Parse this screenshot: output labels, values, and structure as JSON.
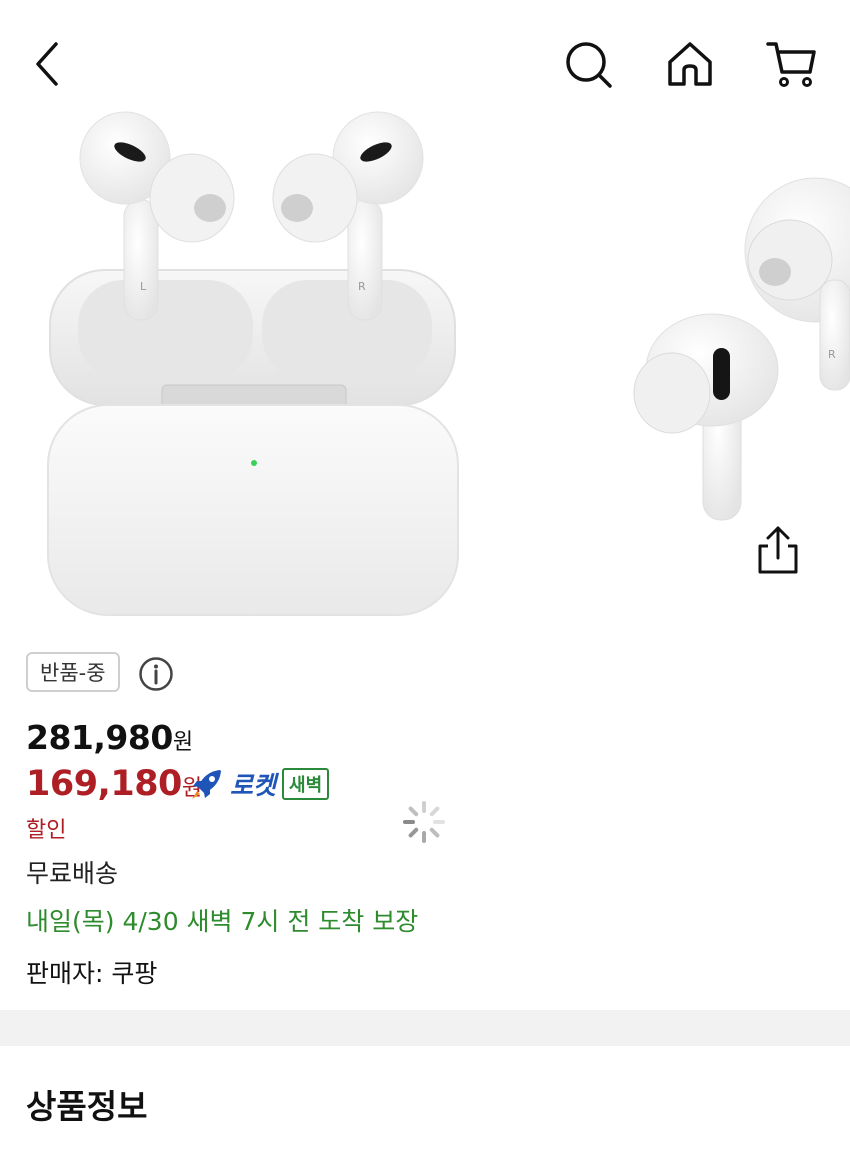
{
  "header": {
    "back_icon": "chevron-left-icon",
    "search_icon": "search-icon",
    "home_icon": "home-icon",
    "cart_icon": "cart-icon"
  },
  "gallery": {
    "share_icon": "share-icon",
    "earbud_left_mark": "L",
    "earbud_right_mark": "R",
    "peek_earbud_mark": "R"
  },
  "product": {
    "badge_label": "반품-중",
    "info_icon": "info-icon",
    "original_price": "281,980",
    "original_price_unit": "원",
    "sale_price": "169,180",
    "sale_price_unit": "원",
    "rocket_label": "로켓",
    "dawn_label": "새벽",
    "discount_label": "할인",
    "shipping_label": "무료배송",
    "delivery_text": "내일(목) 4/30 새벽 7시 전 도착 보장",
    "seller_text": "판매자: 쿠팡"
  },
  "section": {
    "title": "상품정보"
  },
  "colors": {
    "sale_red": "#ae1e25",
    "rocket_blue": "#1f54b8",
    "delivery_green": "#2e8b2e"
  }
}
